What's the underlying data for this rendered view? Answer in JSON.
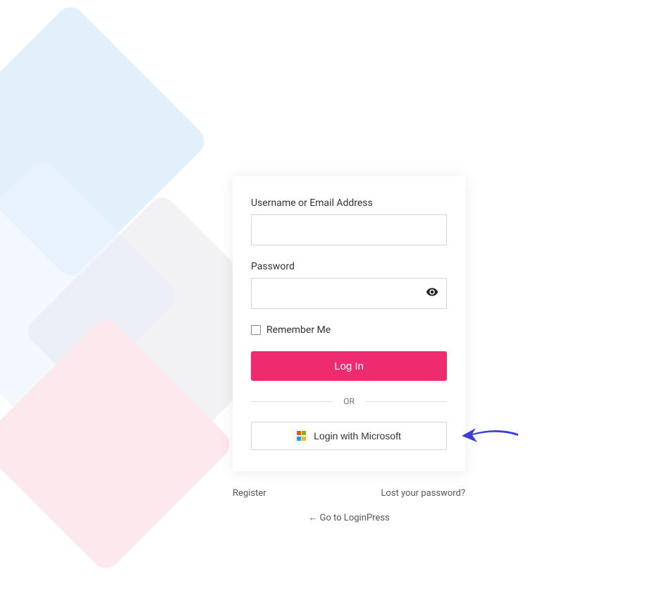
{
  "form": {
    "username_label": "Username or Email Address",
    "username_value": "",
    "password_label": "Password",
    "password_value": "",
    "remember_label": "Remember Me",
    "login_button": "Log In",
    "divider_text": "OR",
    "microsoft_button": "Login with Microsoft"
  },
  "links": {
    "register": "Register",
    "lost_password": "Lost your password?",
    "back": "← Go to LoginPress"
  },
  "colors": {
    "primary": "#ef2b70",
    "arrow": "#3d3dd8"
  }
}
